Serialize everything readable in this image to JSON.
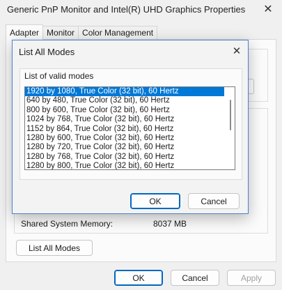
{
  "window": {
    "title": "Generic PnP Monitor and Intel(R) UHD Graphics Properties",
    "close_glyph": "✕",
    "tabs": [
      {
        "label": "Adapter"
      },
      {
        "label": "Monitor"
      },
      {
        "label": "Color Management"
      }
    ],
    "shared_memory_label": "Shared System Memory:",
    "shared_memory_value": "8037 MB",
    "list_all_modes_label": "List All Modes",
    "ok_label": "OK",
    "cancel_label": "Cancel",
    "apply_label": "Apply"
  },
  "dialog": {
    "title": "List All Modes",
    "close_glyph": "✕",
    "group_label": "List of valid modes",
    "modes": [
      "1920 by 1080, True Color (32 bit), 60 Hertz",
      "640 by 480, True Color (32 bit), 60 Hertz",
      "800 by 600, True Color (32 bit), 60 Hertz",
      "1024 by 768, True Color (32 bit), 60 Hertz",
      "1152 by 864, True Color (32 bit), 60 Hertz",
      "1280 by 600, True Color (32 bit), 60 Hertz",
      "1280 by 720, True Color (32 bit), 60 Hertz",
      "1280 by 768, True Color (32 bit), 60 Hertz",
      "1280 by 800, True Color (32 bit), 60 Hertz"
    ],
    "selected_index": 0,
    "ok_label": "OK",
    "cancel_label": "Cancel"
  },
  "colors": {
    "accent": "#0067c0",
    "selection": "#0078d7",
    "dialog_border": "#4a7fd0"
  }
}
